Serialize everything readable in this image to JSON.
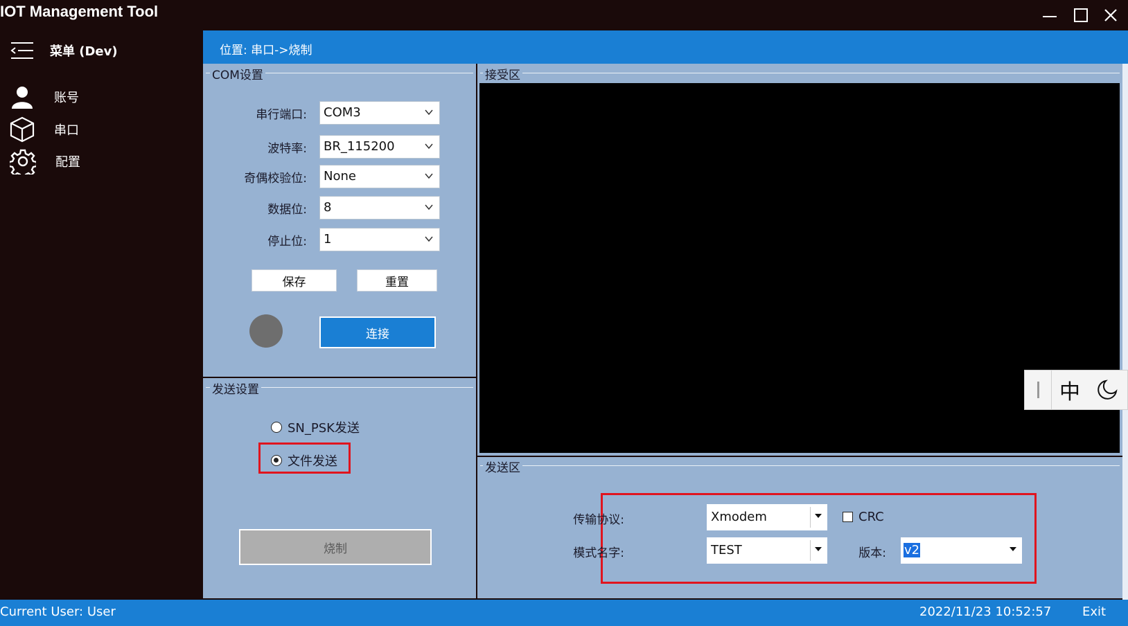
{
  "window": {
    "title": "IOT Management Tool",
    "minimize_icon": "minimize-icon",
    "maximize_icon": "maximize-icon",
    "close_icon": "close-icon"
  },
  "sidebar": {
    "menu_label": "菜单 (Dev)",
    "items": [
      {
        "label": "账号",
        "icon": "user-icon"
      },
      {
        "label": "串口",
        "icon": "cube-icon"
      },
      {
        "label": "配置",
        "icon": "gear-icon"
      }
    ]
  },
  "header": {
    "breadcrumb": "位置: 串口->烧制"
  },
  "com_settings": {
    "title": "COM设置",
    "fields": [
      {
        "label": "串行端口:",
        "value": "COM3"
      },
      {
        "label": "波特率:",
        "value": "BR_115200"
      },
      {
        "label": "奇偶校验位:",
        "value": "None"
      },
      {
        "label": "数据位:",
        "value": "8"
      },
      {
        "label": "停止位:",
        "value": "1"
      }
    ],
    "save_label": "保存",
    "reset_label": "重置",
    "connect_label": "连接",
    "status_color": "#6e6e6e"
  },
  "send_settings": {
    "title": "发送设置",
    "options": [
      {
        "label": "SN_PSK发送",
        "checked": false
      },
      {
        "label": "文件发送",
        "checked": true
      }
    ],
    "burn_label": "烧制"
  },
  "receive_area": {
    "title": "接受区"
  },
  "send_area": {
    "title": "发送区",
    "protocol_label": "传输协议:",
    "protocol_value": "Xmodem",
    "crc_label": "CRC",
    "crc_checked": false,
    "model_label": "模式名字:",
    "model_value": "TEST",
    "version_label": "版本:",
    "version_value": "v2"
  },
  "ime": {
    "mode_label": "中",
    "moon_icon": "moon-icon"
  },
  "statusbar": {
    "user": "Current User: User",
    "datetime": "2022/11/23 10:52:57",
    "exit_label": "Exit"
  },
  "colors": {
    "accent": "#1a7fd4",
    "panel": "#97b2d2",
    "highlight": "#e0141e"
  }
}
